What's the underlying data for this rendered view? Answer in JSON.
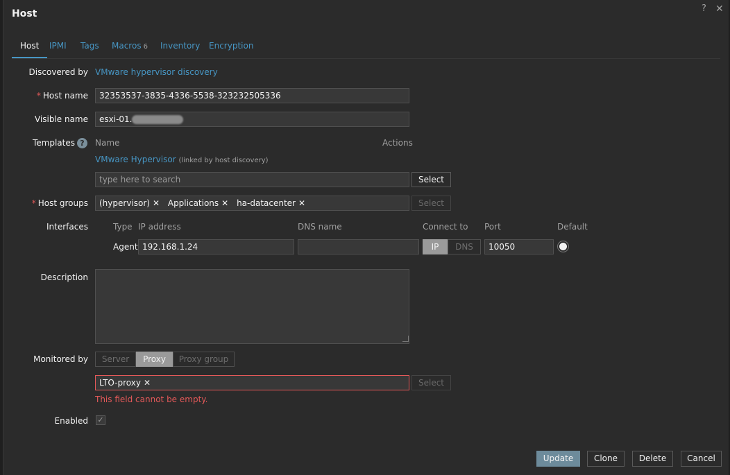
{
  "dialog": {
    "title": "Host",
    "help_icon": "?",
    "close_icon": "✕"
  },
  "tabs": [
    {
      "label": "Host"
    },
    {
      "label": "IPMI"
    },
    {
      "label": "Tags"
    },
    {
      "label": "Macros",
      "count": "6"
    },
    {
      "label": "Inventory"
    },
    {
      "label": "Encryption"
    }
  ],
  "form": {
    "discovered_by_label": "Discovered by",
    "discovered_by_value": "VMware hypervisor discovery",
    "host_name_label": "Host name",
    "host_name_value": "32353537-3835-4336-5538-323232505336",
    "visible_name_label": "Visible name",
    "visible_name_value": "esxi-01.",
    "templates_label": "Templates",
    "templates_col_name": "Name",
    "templates_col_actions": "Actions",
    "template_link": "VMware Hypervisor",
    "template_note": "(linked by host discovery)",
    "template_search_placeholder": "type here to search",
    "select_label": "Select",
    "host_groups_label": "Host groups",
    "host_groups": [
      "(hypervisor)",
      "Applications",
      "ha-datacenter"
    ],
    "interfaces_label": "Interfaces",
    "iface_cols": {
      "type": "Type",
      "ip": "IP address",
      "dns": "DNS name",
      "connect": "Connect to",
      "port": "Port",
      "default": "Default"
    },
    "iface_row": {
      "type": "Agent",
      "ip": "192.168.1.24",
      "dns": "",
      "connect_ip": "IP",
      "connect_dns": "DNS",
      "port": "10050"
    },
    "description_label": "Description",
    "description_value": "",
    "monitored_by_label": "Monitored by",
    "monitored_options": [
      "Server",
      "Proxy",
      "Proxy group"
    ],
    "monitored_selected": "Proxy",
    "proxy_value": "LTO-proxy",
    "proxy_error": "This field cannot be empty.",
    "enabled_label": "Enabled",
    "enabled_mark": "✓"
  },
  "footer": {
    "update": "Update",
    "clone": "Clone",
    "delete": "Delete",
    "cancel": "Cancel"
  },
  "colors": {
    "accent": "#4796c4",
    "error": "#e45959",
    "primary_button": "#6d8b9b"
  }
}
